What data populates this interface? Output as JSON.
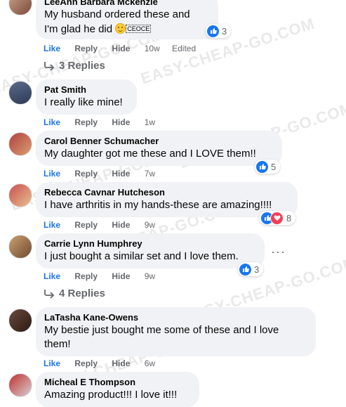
{
  "actions": {
    "like": "Like",
    "reply": "Reply",
    "hide": "Hide",
    "edited": "Edited"
  },
  "comments": [
    {
      "author": "LeeAnn Barbara Mckenzie",
      "text": "My husband ordered these and",
      "text2": "I'm glad he did",
      "emoji_note": "CEOCE",
      "time": "10w",
      "reactions": "3",
      "replies": "3 Replies"
    },
    {
      "author": "Pat Smith",
      "text": "I really like mine!",
      "time": "1w"
    },
    {
      "author": "Carol Benner Schumacher",
      "text": "My daughter got me these and I LOVE them!!",
      "time": "7w",
      "reactions": "5"
    },
    {
      "author": "Rebecca Cavnar Hutcheson",
      "text": "I have arthritis in my hands-these are amazing!!!!",
      "time": "9w",
      "reactions": "8"
    },
    {
      "author": "Carrie Lynn Humphrey",
      "text": "I just bought a similar set and I love them.",
      "time": "9w",
      "reactions": "3",
      "replies": "4 Replies"
    },
    {
      "author": "LaTasha Kane-Owens",
      "text": "My bestie just bought me some of these and I love",
      "text2": "them!",
      "time": "6w"
    },
    {
      "author": "Micheal E Thompson",
      "text": "Amazing product!!! I love it!!!"
    }
  ],
  "watermark": "EASY-CHEAP-GO.COM",
  "colors": {
    "like_blue": "#1b74e4",
    "bubble": "#f0f2f5",
    "meta_gray": "#65676b",
    "love_red": "#f33e58"
  }
}
